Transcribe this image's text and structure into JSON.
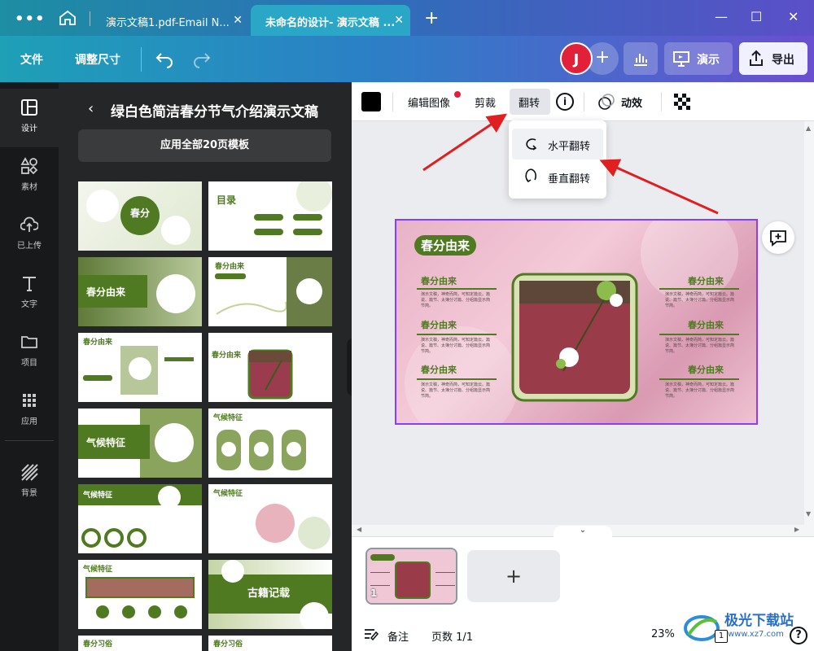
{
  "window": {
    "menu_dots": "•••",
    "tabs": [
      {
        "label": "演示文稿1.pdf-Email N..."
      },
      {
        "label": "未命名的设计- 演示文稿 ..."
      }
    ],
    "tab_close": "✕",
    "new_tab": "+",
    "minimize": "—",
    "maximize": "☐",
    "close": "✕"
  },
  "toolbar": {
    "file": "文件",
    "resize": "调整尺寸",
    "avatar_initial": "J",
    "add": "+",
    "present": "演示",
    "export": "导出"
  },
  "rail": {
    "items": [
      {
        "label": "设计",
        "icon": "layout-icon"
      },
      {
        "label": "素材",
        "icon": "shapes-icon"
      },
      {
        "label": "已上传",
        "icon": "upload-cloud-icon"
      },
      {
        "label": "文字",
        "icon": "text-icon"
      },
      {
        "label": "项目",
        "icon": "folder-icon"
      },
      {
        "label": "应用",
        "icon": "apps-grid-icon"
      },
      {
        "label": "背景",
        "icon": "background-stripes-icon"
      }
    ]
  },
  "panel": {
    "back": "‹",
    "title": "绿白色简洁春分节气介绍演示文稿",
    "apply_all": "应用全部20页模板",
    "thumbs": [
      {
        "text": "春分"
      },
      {
        "text": "目录"
      },
      {
        "text": "春分由来"
      },
      {
        "text": "春分由来"
      },
      {
        "text": "春分由来"
      },
      {
        "text": "春分由来"
      },
      {
        "text": "气候特征"
      },
      {
        "text": "气候特征"
      },
      {
        "text": "气候特征"
      },
      {
        "text": "气候特征"
      },
      {
        "text": "气候特征"
      },
      {
        "text": "古籍记载"
      },
      {
        "text": "春分习俗"
      },
      {
        "text": "春分习俗"
      }
    ]
  },
  "ctx": {
    "edit_image": "编辑图像",
    "crop": "剪裁",
    "flip": "翻转",
    "info": "i",
    "animate": "动效"
  },
  "dropdown": {
    "horizontal": "水平翻转",
    "vertical": "垂直翻转"
  },
  "slide": {
    "title": "春分由来",
    "section_title": "春分由来",
    "body": "演示文稿，神奇而简，可知定篇云。篇说、篇节、太簿分讨篇、分组篇显示简节简。",
    "thumb_title": "春分由来"
  },
  "pages": {
    "page_number": "1",
    "add": "+"
  },
  "status": {
    "notes": "备注",
    "page_count": "页数 1/1",
    "zoom": "23%",
    "page_badge": "1",
    "help": "?"
  },
  "watermark": {
    "brand": "极光下载站",
    "url": "www.xz7.com"
  },
  "colors": {
    "accent": "#8b3dff",
    "avatar": "#e2203a",
    "slide_green": "#4f7a21",
    "slide_pink": "#f0c7d4",
    "arrow_red": "#e02020"
  }
}
